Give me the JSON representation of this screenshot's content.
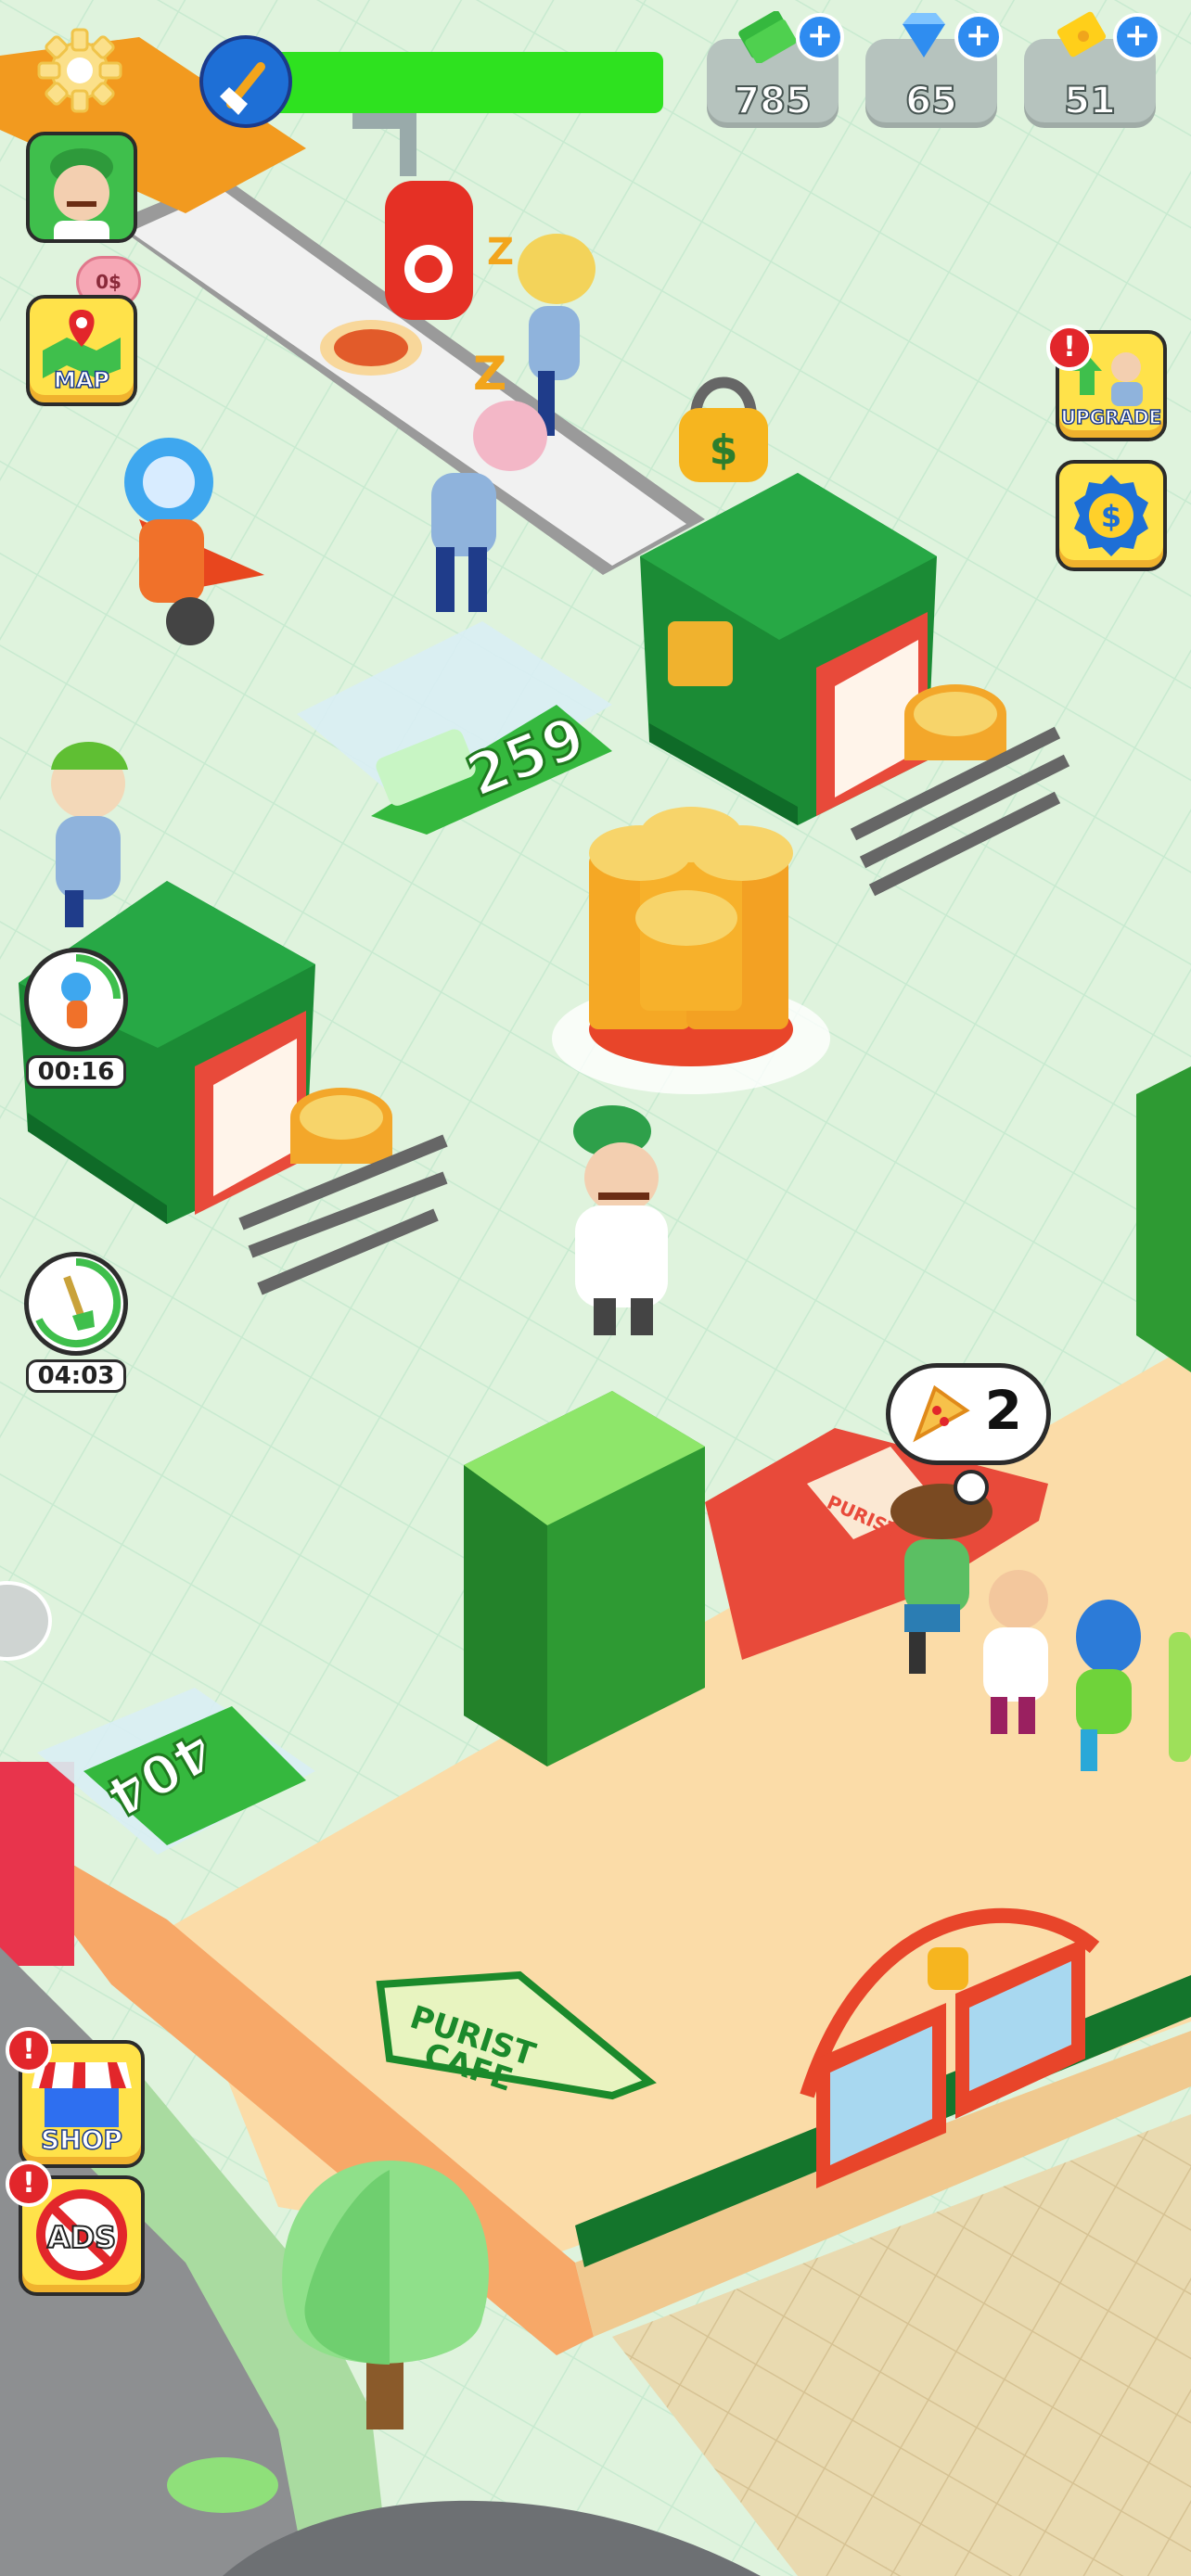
{
  "hud": {
    "cash": "785",
    "gems": "65",
    "tickets": "51",
    "plus_symbol": "+",
    "progress": 1.0
  },
  "buttons": {
    "map": "MAP",
    "upgrade": "UPGRADE",
    "shop": "SHOP",
    "ads": "ADS",
    "alert_symbol": "!"
  },
  "piggy_bank": "0$",
  "timers": {
    "robot": "00:16",
    "broom": "04:03"
  },
  "world": {
    "unlock_price_upper": "259",
    "unlock_price_lower": "404",
    "order_count": "2",
    "cafe_sign_line1": "PURIST",
    "cafe_sign_line2": "CAFE",
    "counter_box_text": "PURIST",
    "machine_lock_symbol": "$",
    "lock_price_symbol": "$"
  },
  "colors": {
    "grass": "#dff3dd",
    "floor_sand": "#fbdca8",
    "machine_green": "#1f9a3b",
    "money_green": "#35b83e",
    "accent_yellow": "#ffe24a",
    "alert_red": "#e2262b",
    "progress_green": "#2ee21f"
  },
  "icons": {
    "settings": "gear-icon",
    "cleaner": "broom-icon",
    "cash": "cash-icon",
    "gems": "gem-icon",
    "tickets": "ticket-icon",
    "map": "map-pin-icon",
    "upgrade": "upgrade-arrows-icon",
    "vip": "coin-badge-icon",
    "shop": "shop-awning-icon",
    "ads": "no-ads-icon"
  }
}
